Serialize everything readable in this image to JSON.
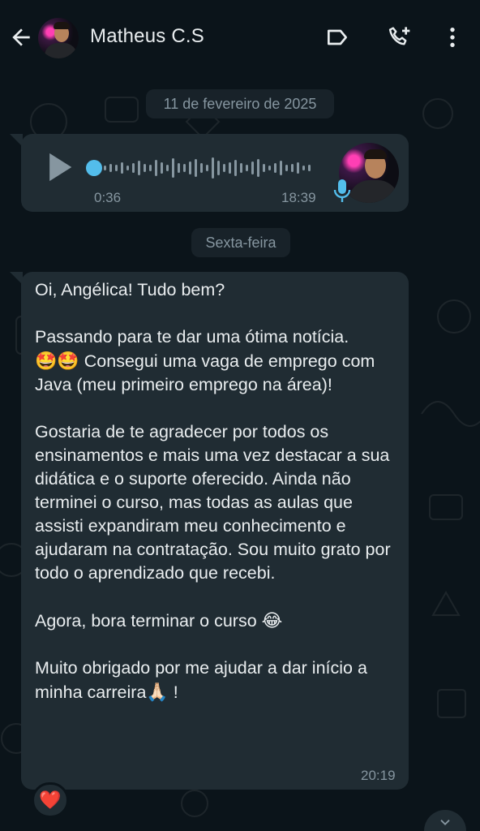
{
  "header": {
    "contact_name": "Matheus C.S",
    "icons": [
      "arrow-back-icon",
      "label-icon",
      "add-call-icon",
      "more-vert-icon"
    ]
  },
  "chips": {
    "date": "11 de fevereiro de 2025",
    "day": "Sexta-feira"
  },
  "voice_message": {
    "duration": "0:36",
    "time": "18:39",
    "progress": 0.0,
    "icons": [
      "play-icon",
      "mic-icon"
    ]
  },
  "text_message": {
    "greeting": "Oi, Angélica! Tudo bem?",
    "paragraph1_start": "Passando para te dar uma ótima notícia.",
    "emoji_stars": "🤩🤩",
    "paragraph1_end": " Consegui uma vaga de emprego com Java (meu primeiro emprego na área)!",
    "paragraph2": "Gostaria de te agradecer por todos os ensinamentos e mais uma vez destacar a sua didática e o suporte oferecido. Ainda não terminei o curso, mas todas as aulas que assisti expandiram meu conhecimento e ajudaram na contratação. Sou muito grato por todo o aprendizado que recebi.",
    "paragraph3": "Agora, bora terminar o curso ",
    "emoji_laugh": "😂",
    "paragraph4_start": "Muito obrigado por me ajudar a dar início a minha carreira",
    "emoji_pray": "🙏🏻",
    "paragraph4_end": " !",
    "time": "20:19"
  },
  "reaction": {
    "emoji": "❤️"
  },
  "colors": {
    "background": "#0b141a",
    "bubble": "#202c33",
    "secondary_text": "#8696a0",
    "accent_blue": "#53bdeb"
  }
}
